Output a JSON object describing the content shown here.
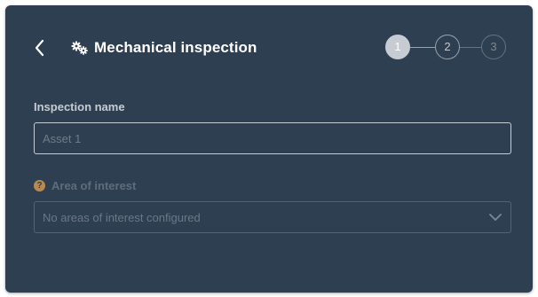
{
  "header": {
    "title": "Mechanical inspection",
    "back_icon": "chevron-left-icon",
    "title_icon": "gears-icon"
  },
  "stepper": {
    "steps": [
      "1",
      "2",
      "3"
    ],
    "current_step": 1
  },
  "form": {
    "inspection_name": {
      "label": "Inspection name",
      "placeholder": "Asset 1",
      "value": ""
    },
    "area_of_interest": {
      "label": "Area of interest",
      "help_icon": "?",
      "selected": "No areas of interest configured",
      "disabled": true
    }
  },
  "colors": {
    "panel_bg": "#2f3f52",
    "text_primary": "#ffffff",
    "help_icon": "#b98a50"
  }
}
